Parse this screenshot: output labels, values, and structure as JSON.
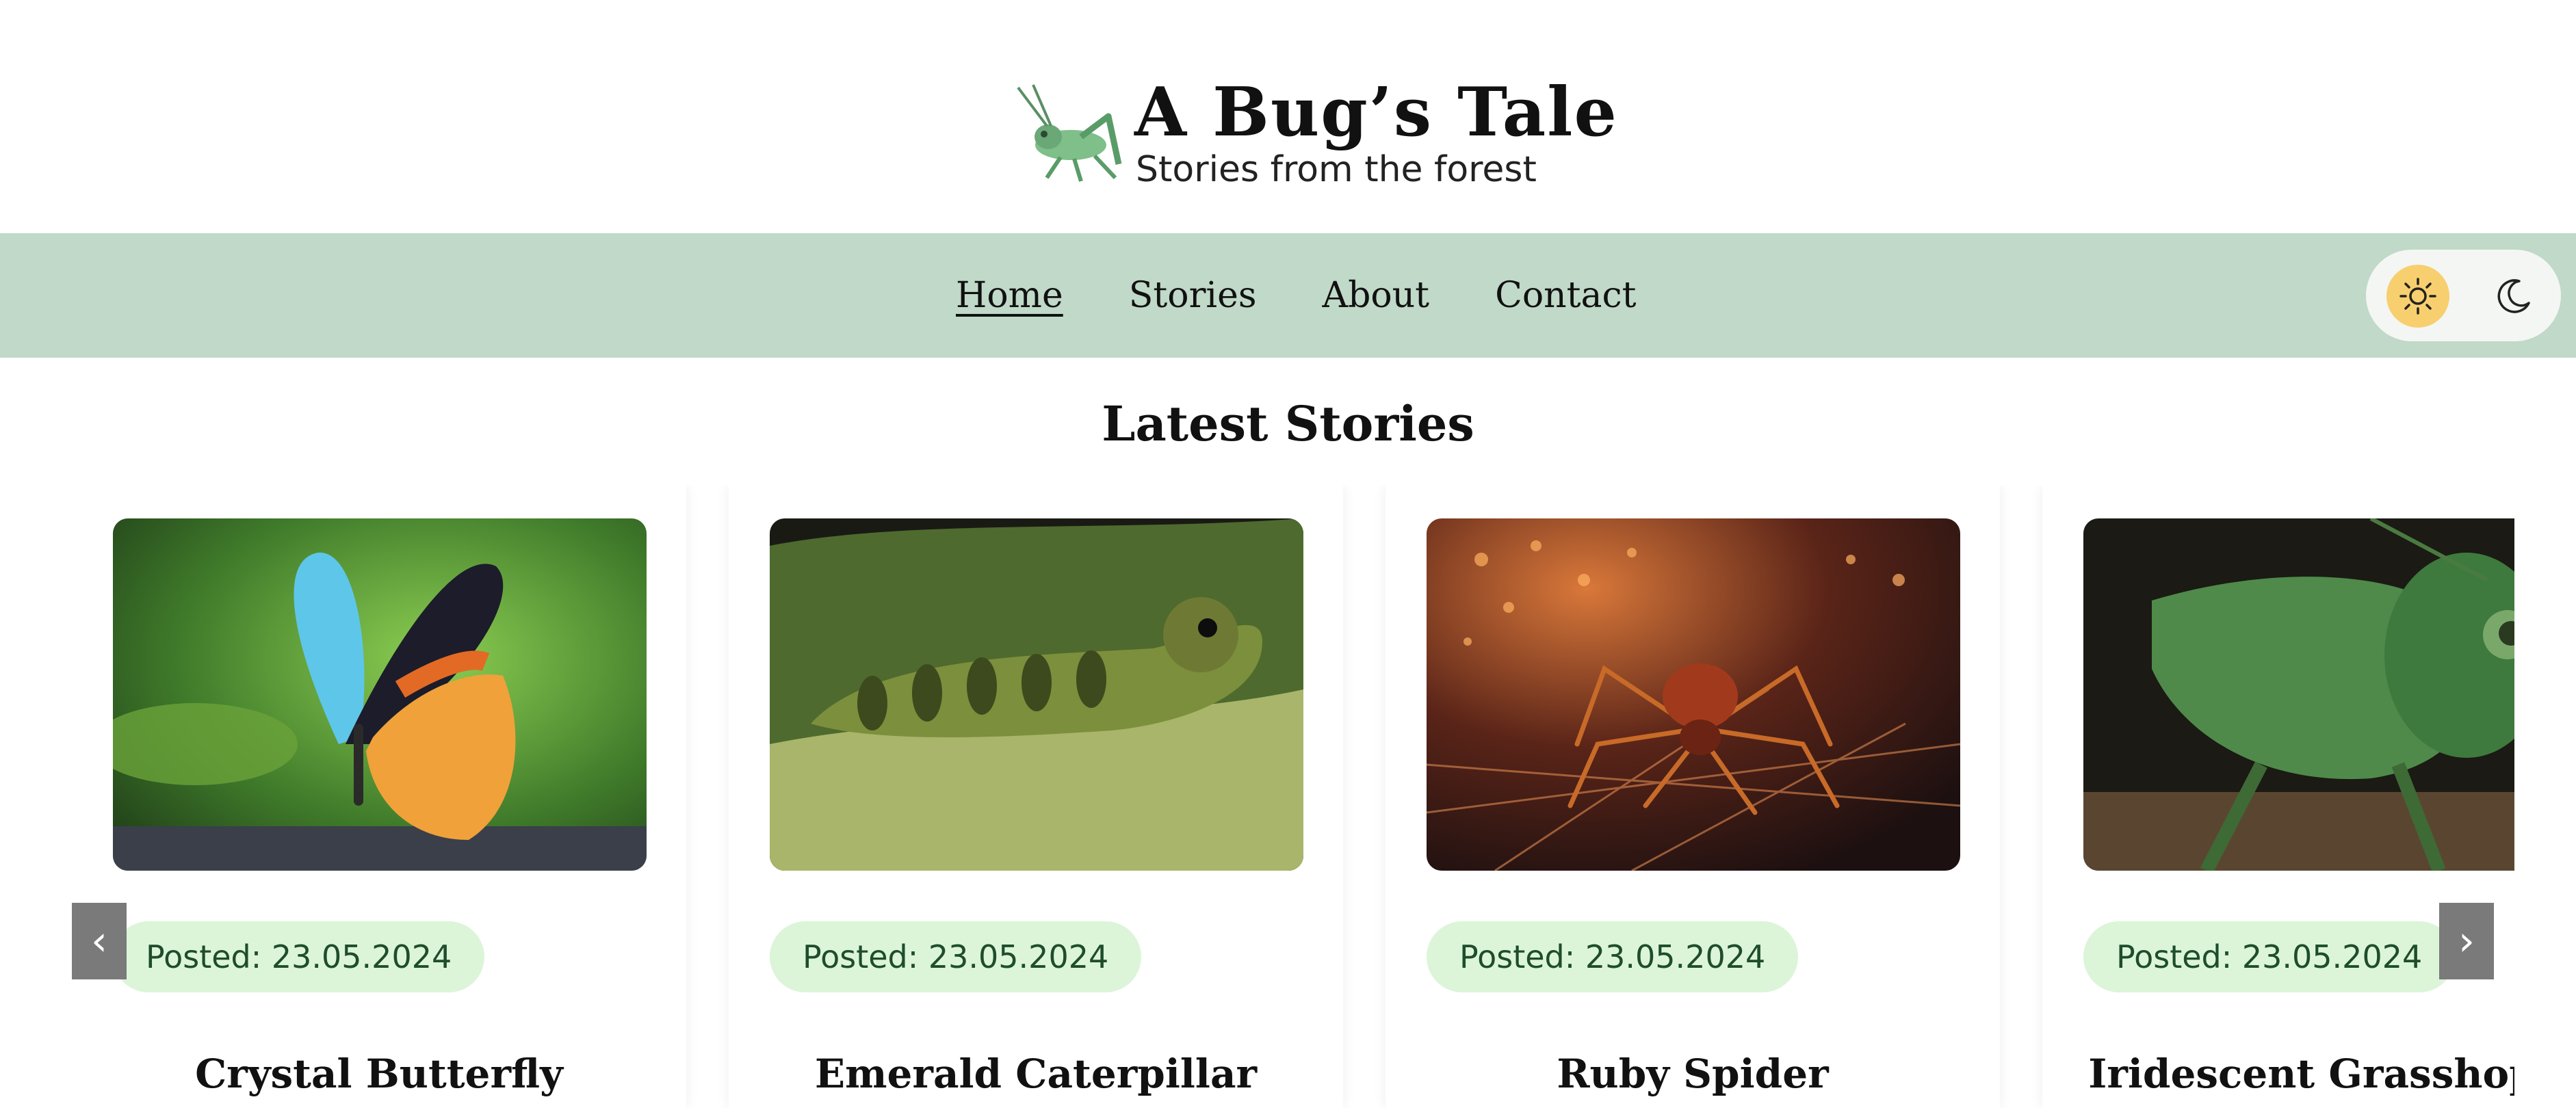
{
  "brand": {
    "title": "A Bug’s Tale",
    "subtitle": "Stories from the forest",
    "logo_icon": "grasshopper-icon"
  },
  "nav": {
    "items": [
      {
        "label": "Home",
        "active": true
      },
      {
        "label": "Stories",
        "active": false
      },
      {
        "label": "About",
        "active": false
      },
      {
        "label": "Contact",
        "active": false
      }
    ],
    "theme": {
      "light_icon": "sun-icon",
      "dark_icon": "moon-icon",
      "selected": "light"
    }
  },
  "main": {
    "section_title": "Latest Stories",
    "cards": [
      {
        "title": "Crystal Butterfly",
        "posted": "Posted: 23.05.2024",
        "image": "butterfly-image"
      },
      {
        "title": "Emerald Caterpillar",
        "posted": "Posted: 23.05.2024",
        "image": "caterpillar-image"
      },
      {
        "title": "Ruby Spider",
        "posted": "Posted: 23.05.2024",
        "image": "spider-image"
      },
      {
        "title": "Iridescent Grasshopper",
        "posted": "Posted: 23.05.2024",
        "image": "grasshopper-image"
      }
    ],
    "carousel": {
      "prev_label": "‹",
      "next_label": "›"
    }
  },
  "colors": {
    "nav_bg": "#c0d9c8",
    "badge_bg": "#dcf5d9",
    "badge_text": "#1e4d2b",
    "sun_bg": "#f7cf6e",
    "arrow_bg": "#7a7a7a"
  }
}
